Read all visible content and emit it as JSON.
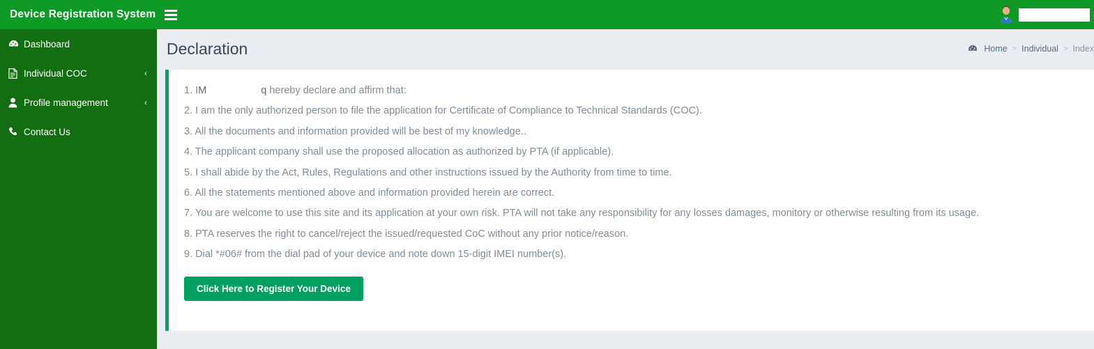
{
  "header": {
    "brand": "Device Registration System",
    "menu_toggle_icon": "hamburger-icon",
    "avatar_icon": "user-avatar-icon",
    "username": ""
  },
  "sidebar": {
    "items": [
      {
        "label": "Dashboard",
        "icon": "dashboard-gauge-icon",
        "has_chevron": false
      },
      {
        "label": "Individual COC",
        "icon": "document-file-icon",
        "has_chevron": true,
        "chevron": "‹"
      },
      {
        "label": "Profile management",
        "icon": "user-icon",
        "has_chevron": true,
        "chevron": "‹"
      },
      {
        "label": "Contact Us",
        "icon": "phone-icon",
        "has_chevron": false
      }
    ]
  },
  "main": {
    "title": "Declaration",
    "breadcrumb": {
      "icon": "dashboard-gauge-icon",
      "home": "Home",
      "sep1": ">",
      "section": "Individual",
      "sep2": ">",
      "current": "Index"
    },
    "declaration": {
      "items": [
        {
          "number": "1.",
          "prefix": "I",
          "name_fragment_start": "M",
          "name_fragment_end": "q",
          "suffix": "hereby declare and affirm that:",
          "redacted": true
        },
        {
          "number": "2.",
          "text": "I am the only authorized person to file the application for Certificate of Compliance to Technical Standards (COC)."
        },
        {
          "number": "3.",
          "text": "All the documents and information provided will be best of my knowledge.."
        },
        {
          "number": "4.",
          "text": "The applicant company shall use the proposed allocation as authorized by PTA (if applicable)."
        },
        {
          "number": "5.",
          "text": "I shall abide by the Act, Rules, Regulations and other instructions issued by the Authority from time to time."
        },
        {
          "number": "6.",
          "text": "All the statements mentioned above and information provided herein are correct."
        },
        {
          "number": "7.",
          "text": "You are welcome to use this site and its application at your own risk. PTA will not take any responsibility for any losses damages, monitory or otherwise resulting from its usage."
        },
        {
          "number": "8.",
          "text": "PTA reserves the right to cancel/reject the issued/requested CoC without any prior notice/reason."
        },
        {
          "number": "9.",
          "text": "Dial *#06# from the dial pad of your device and note down 15-digit IMEI number(s)."
        }
      ],
      "register_button": "Click Here to Register Your Device"
    }
  },
  "colors": {
    "header_green": "#0f9a27",
    "sidebar_green": "#136d11",
    "accent_green": "#00a65a",
    "button_green": "#00a160",
    "page_bg": "#eaedf2",
    "text_muted": "#7f8c9a"
  }
}
